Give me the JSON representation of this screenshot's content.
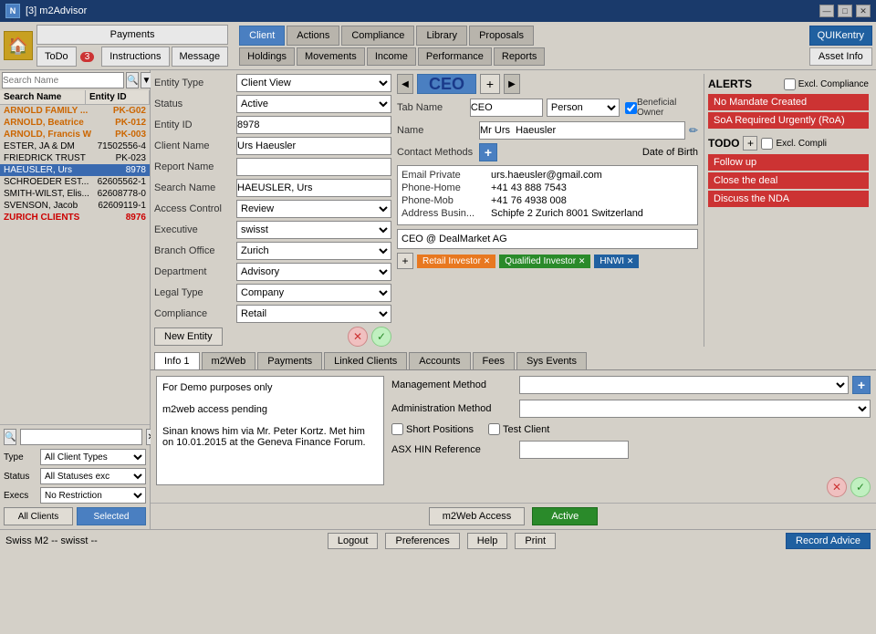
{
  "titleBar": {
    "icon": "N",
    "title": "[3] m2Advisor",
    "controls": [
      "—",
      "□",
      "✕"
    ]
  },
  "toolbar": {
    "homeIcon": "🏠",
    "paymentsLabel": "Payments",
    "todoLabel": "ToDo",
    "todoBadge": "3",
    "instructionsLabel": "Instructions",
    "messageLabel": "Message",
    "quikLabel": "QUIKentry",
    "assetLabel": "Asset Info",
    "navTabs": [
      "Client",
      "Actions",
      "Compliance",
      "Library",
      "Proposals"
    ],
    "subTabs": [
      "Holdings",
      "Movements",
      "Income",
      "Performance",
      "Reports"
    ]
  },
  "clientList": {
    "searchPlaceholder": "Search Name",
    "col1": "Search Name",
    "col2": "Entity ID",
    "clients": [
      {
        "name": "ARNOLD FAMILY ...",
        "id": "PK-G02",
        "color": "orange"
      },
      {
        "name": "ARNOLD, Beatrice",
        "id": "PK-012",
        "color": "orange"
      },
      {
        "name": "ARNOLD, Francis W",
        "id": "PK-003",
        "color": "orange"
      },
      {
        "name": "ESTER, JA & DM",
        "id": "71502556-4",
        "color": "normal"
      },
      {
        "name": "FRIEDRICK TRUST",
        "id": "PK-023",
        "color": "normal"
      },
      {
        "name": "HAEUSLER, Urs",
        "id": "8978",
        "color": "selected"
      },
      {
        "name": "SCHROEDER EST...",
        "id": "62605562-1",
        "color": "normal"
      },
      {
        "name": "SMITH-WILST, Elis...",
        "id": "62608778-0",
        "color": "normal"
      },
      {
        "name": "SVENSON, Jacob",
        "id": "62609119-1",
        "color": "normal"
      },
      {
        "name": "ZURICH CLIENTS",
        "id": "8976",
        "color": "red"
      }
    ],
    "filterType": "All Client Types",
    "filterStatus": "All Statuses exc",
    "filterExecs": "No Restriction",
    "btnAllClients": "All Clients",
    "btnSelected": "Selected"
  },
  "entityForm": {
    "entityTypeLabel": "Entity Type",
    "entityTypeValue": "Client View",
    "statusLabel": "Status",
    "statusValue": "Active",
    "entityIdLabel": "Entity ID",
    "entityIdValue": "8978",
    "clientNameLabel": "Client Name",
    "clientNameValue": "Urs Haeusler",
    "reportNameLabel": "Report Name",
    "searchNameLabel": "Search Name",
    "searchNameValue": "HAEUSLER, Urs",
    "accessControlLabel": "Access Control",
    "accessControlValue": "Review",
    "executiveLabel": "Executive",
    "executiveValue": "swisst",
    "branchOfficeLabel": "Branch Office",
    "branchOfficeValue": "Zurich",
    "departmentLabel": "Department",
    "departmentValue": "Advisory",
    "legalTypeLabel": "Legal Type",
    "legalTypeValue": "Company",
    "complianceLabel": "Compliance",
    "complianceValue": "Retail",
    "newEntityBtn": "New Entity"
  },
  "ceoPanel": {
    "prevArrow": "◀",
    "nextArrow": "▶",
    "tabName": "CEO",
    "addBtn": "+",
    "tabNameLabel": "Tab Name",
    "tabNameValue": "CEO",
    "personType": "Person",
    "beneficialOwnerLabel": "Beneficial Owner",
    "nameLabel": "Name",
    "nameValue": "Mr Urs  Haeusler",
    "contactMethodsLabel": "Contact Methods",
    "dobLabel": "Date of Birth",
    "emailLabel": "Email Private",
    "emailValue": "urs.haeusler@gmail.com",
    "phoneHomeLabel": "Phone-Home",
    "phoneHomeValue": "+41 43 888 7543",
    "phoneMobLabel": "Phone-Mob",
    "phoneMobValue": "+41 76 4938 008",
    "addressLabel": "Address Busin...",
    "addressValue": "Schipfe 2   Zurich 8001 Switzerland",
    "companyRole": "CEO @ DealMarket AG",
    "tags": [
      "Retail Investor",
      "Qualified Investor",
      "HNWI"
    ],
    "alertsTitle": "ALERTS",
    "exclComplianceLabel": "Excl. Compliance",
    "alerts": [
      "No Mandate Created",
      "SoA Required Urgently (RoA)"
    ],
    "todoTitle": "TODO",
    "exclCompliLabel": "Excl. Compli",
    "todos": [
      "Follow up",
      "Close the deal",
      "Discuss the NDA"
    ]
  },
  "bottomTabs": {
    "tabs": [
      "Info 1",
      "m2Web",
      "Payments",
      "Linked Clients",
      "Accounts",
      "Fees",
      "Sys Events"
    ],
    "activeTab": "Info 1",
    "infoText": "For Demo purposes only\n\nm2web access pending\n\nSinan knows him via Mr. Peter Kortz. Met him on 10.01.2015 at the Geneva Finance Forum.",
    "managementMethodLabel": "Management Method",
    "administrationMethodLabel": "Administration Method",
    "shortPositionsLabel": "Short Positions",
    "testClientLabel": "Test Client",
    "asxHinLabel": "ASX HIN Reference",
    "m2webBtn": "m2Web Access",
    "activeBtn": "Active"
  },
  "bottomBar": {
    "status": "Swiss M2 -- swisst --",
    "logoutBtn": "Logout",
    "preferencesBtn": "Preferences",
    "helpBtn": "Help",
    "printBtn": "Print",
    "recordAdviceBtn": "Record Advice"
  }
}
